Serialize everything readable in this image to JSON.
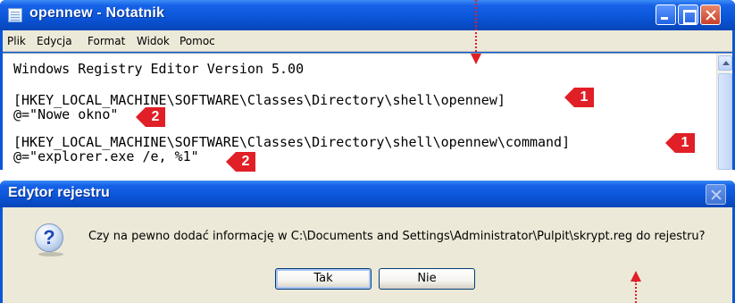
{
  "notepad": {
    "title": "opennew - Notatnik",
    "menu": [
      "Plik",
      "Edycja",
      "Format",
      "Widok",
      "Pomoc"
    ],
    "lines": [
      "Windows Registry Editor Version 5.00",
      "",
      "[HKEY_LOCAL_MACHINE\\SOFTWARE\\Classes\\Directory\\shell\\opennew]",
      "@=\"Nowe okno\"",
      "",
      "[HKEY_LOCAL_MACHINE\\SOFTWARE\\Classes\\Directory\\shell\\opennew\\command]",
      "@=\"explorer.exe /e, %1\""
    ]
  },
  "callouts": [
    "1",
    "2",
    "1",
    "2"
  ],
  "dialog": {
    "title": "Edytor rejestru",
    "icon": "question-icon",
    "message": "Czy na pewno dodać informację w C:\\Documents and Settings\\Administrator\\Pulpit\\skrypt.reg do rejestru?",
    "yes_label": "Tak",
    "no_label": "Nie"
  },
  "colors": {
    "titlebar": "#0a54d6",
    "callout_red": "#e01f26",
    "dialog_bg": "#ece9d8"
  }
}
